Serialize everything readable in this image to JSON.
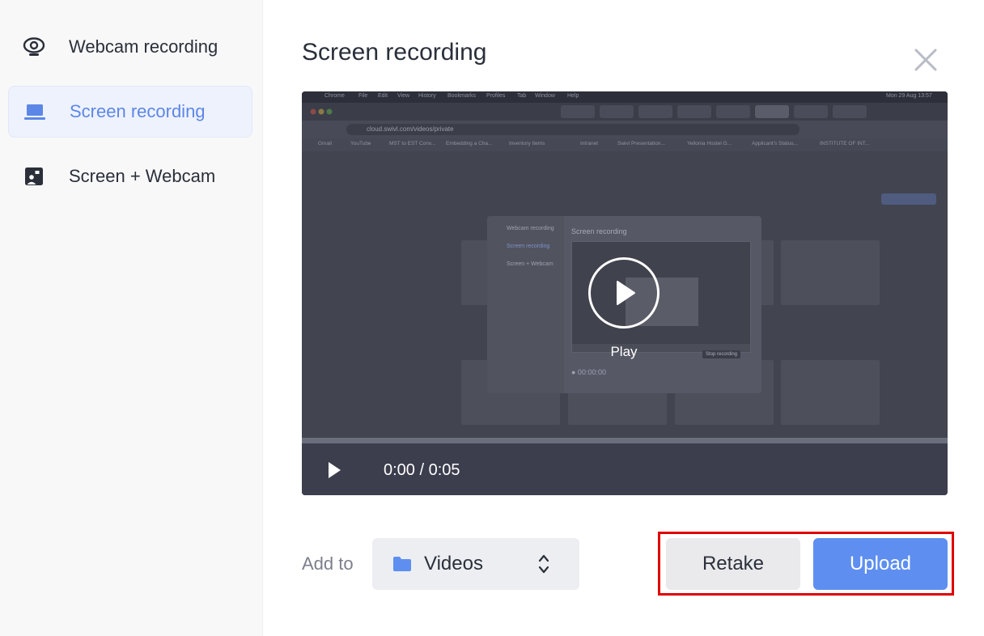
{
  "sidebar": {
    "items": [
      {
        "label": "Webcam recording",
        "icon": "webcam-icon",
        "active": false
      },
      {
        "label": "Screen recording",
        "icon": "laptop-icon",
        "active": true
      },
      {
        "label": "Screen + Webcam",
        "icon": "screen-webcam-icon",
        "active": false
      }
    ]
  },
  "dialog": {
    "title": "Screen recording",
    "close_icon": "close-icon"
  },
  "player": {
    "overlay_label": "Play",
    "time": "0:00 / 0:05",
    "progress": 0,
    "preview": {
      "menubar": [
        "Chrome",
        "File",
        "Edit",
        "View",
        "History",
        "Bookmarks",
        "Profiles",
        "Tab",
        "Window",
        "Help"
      ],
      "clock": "Mon 29 Aug 13:57",
      "url": "cloud.swivl.com/videos/private",
      "bookmarks": [
        "Gmail",
        "YouTube",
        "MST to EST Conv...",
        "Embedding a Cha...",
        "Inventory Items",
        "Intranet",
        "Swivl Presentation...",
        "Yellonia Hostel G...",
        "Applicant's Status...",
        "INSTITUTE OF INT..."
      ],
      "modal": {
        "items": [
          "Webcam recording",
          "Screen recording",
          "Screen + Webcam"
        ],
        "title": "Screen recording",
        "time": "● 00:00:00",
        "tooltip": "Stop recording"
      }
    }
  },
  "footer": {
    "add_to_label": "Add to",
    "folder": {
      "label": "Videos",
      "icon": "folder-icon"
    },
    "retake_label": "Retake",
    "upload_label": "Upload"
  },
  "colors": {
    "accent": "#5e8ff0",
    "active_text": "#5d87e6",
    "highlight": "#e00000"
  }
}
